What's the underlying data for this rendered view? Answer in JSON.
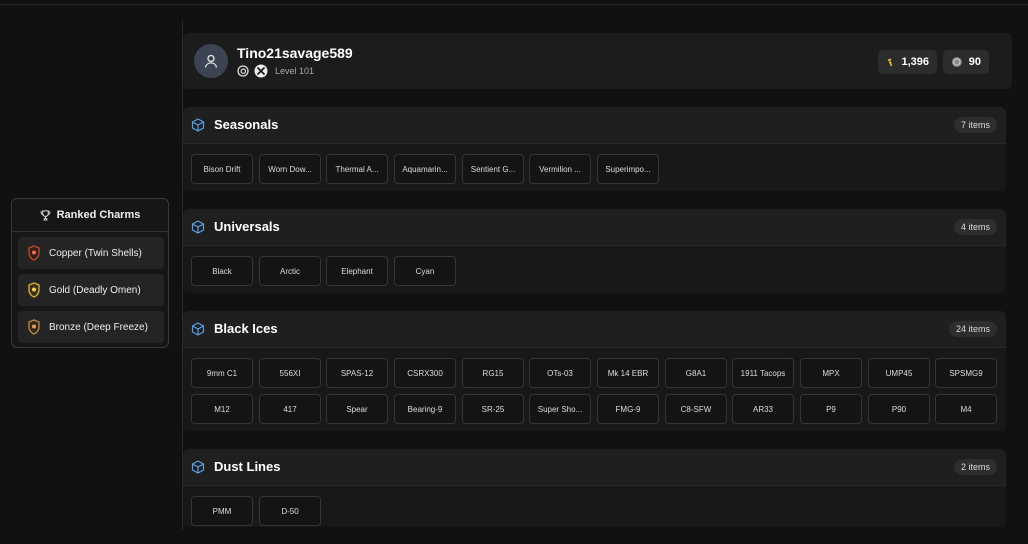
{
  "profile": {
    "username": "Tino21savage589",
    "level": "Level 101",
    "currency_1": "1,396",
    "currency_2": "90"
  },
  "ranked_charms": {
    "title": "Ranked Charms",
    "items": [
      {
        "label": "Copper (Twin Shells)",
        "color": "#c2492f"
      },
      {
        "label": "Gold (Deadly Omen)",
        "color": "#d6b13a"
      },
      {
        "label": "Bronze (Deep Freeze)",
        "color": "#b8874a"
      }
    ]
  },
  "colors": {
    "accent": "#5aa0e6",
    "background": "#111111"
  },
  "sections": [
    {
      "title": "Seasonals",
      "count": "7 items",
      "items": [
        "Bison Drift",
        "Worn Dow...",
        "Thermal A...",
        "Aquamarin...",
        "Sentient G...",
        "Vermilion ...",
        "Superimpo..."
      ]
    },
    {
      "title": "Universals",
      "count": "4 items",
      "items": [
        "Black",
        "Arctic",
        "Elephant",
        "Cyan"
      ]
    },
    {
      "title": "Black Ices",
      "count": "24 items",
      "items": [
        "9mm C1",
        "556XI",
        "SPAS-12",
        "CSRX300",
        "RG15",
        "OTs-03",
        "Mk 14 EBR",
        "G8A1",
        "1911 Tacops",
        "MPX",
        "UMP45",
        "SPSMG9",
        "M12",
        "417",
        "Spear",
        "Bearing-9",
        "SR-25",
        "Super Sho...",
        "FMG-9",
        "C8-SFW",
        "AR33",
        "P9",
        "P90",
        "M4"
      ]
    },
    {
      "title": "Dust Lines",
      "count": "2 items",
      "items": [
        "PMM",
        "D-50"
      ]
    }
  ]
}
